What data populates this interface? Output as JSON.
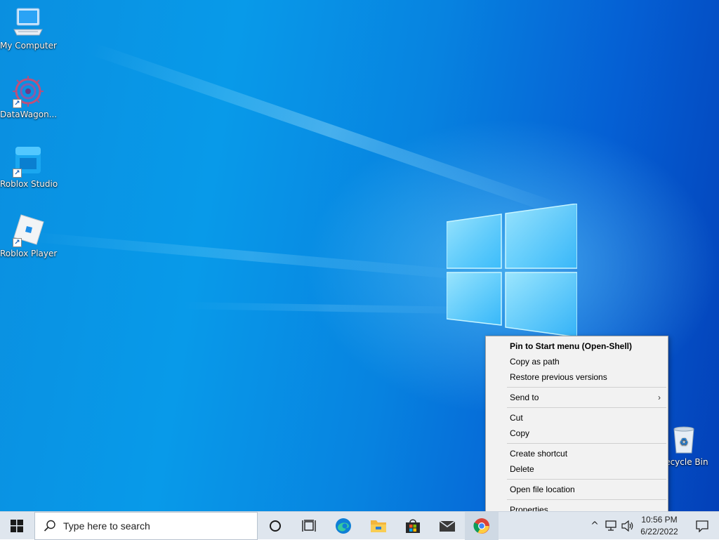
{
  "desktop_icons": [
    {
      "label": "My Computer",
      "icon": "computer-icon"
    },
    {
      "label": "DataWagon...",
      "icon": "datawagon-icon"
    },
    {
      "label": "Roblox Studio",
      "icon": "roblox-studio-icon"
    },
    {
      "label": "Roblox Player",
      "icon": "roblox-player-icon"
    },
    {
      "label": "Recycle Bin",
      "icon": "recycle-bin-icon"
    }
  ],
  "context_menu": {
    "items": [
      {
        "label": "Pin to Start menu (Open-Shell)",
        "bold": true
      },
      {
        "label": "Copy as path"
      },
      {
        "label": "Restore previous versions"
      },
      {
        "label": "Send to",
        "submenu": true
      },
      {
        "label": "Cut"
      },
      {
        "label": "Copy"
      },
      {
        "label": "Create shortcut"
      },
      {
        "label": "Delete"
      },
      {
        "label": "Open file location"
      },
      {
        "label": "Properties"
      }
    ]
  },
  "taskbar": {
    "search_placeholder": "Type here to search",
    "apps": [
      "cortana-icon",
      "task-view-icon",
      "edge-icon",
      "file-explorer-icon",
      "store-icon",
      "mail-icon",
      "chrome-icon"
    ],
    "clock": {
      "time": "10:56 PM",
      "date": "6/22/2022"
    }
  },
  "colors": {
    "wallpaper": "#0a8fe0",
    "taskbar": "#dfe6ee",
    "menu_bg": "#f2f2f2"
  }
}
